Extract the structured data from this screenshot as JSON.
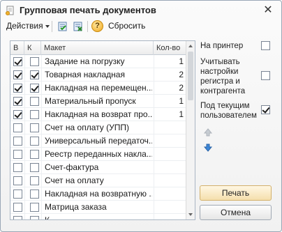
{
  "window": {
    "title": "Групповая печать документов"
  },
  "toolbar": {
    "actions_label": "Действия",
    "reset_label": "Сбросить"
  },
  "table": {
    "columns": [
      "В",
      "К",
      "Макет",
      "Кол-во"
    ],
    "rows": [
      {
        "v": true,
        "k": false,
        "name": "Задание на погрузку",
        "qty": "1"
      },
      {
        "v": true,
        "k": true,
        "name": "Товарная накладная",
        "qty": "2"
      },
      {
        "v": true,
        "k": true,
        "name": "Накладная на перемещен...",
        "qty": "2"
      },
      {
        "v": true,
        "k": false,
        "name": "Материальный пропуск",
        "qty": "1"
      },
      {
        "v": true,
        "k": false,
        "name": "Накладная на возврат про...",
        "qty": "1"
      },
      {
        "v": false,
        "k": false,
        "name": "Счет на оплату (УПП)",
        "qty": ""
      },
      {
        "v": false,
        "k": false,
        "name": "Универсальный передаточ...",
        "qty": ""
      },
      {
        "v": false,
        "k": false,
        "name": "Реестр переданных накла...",
        "qty": ""
      },
      {
        "v": false,
        "k": false,
        "name": "Счет-фактура",
        "qty": ""
      },
      {
        "v": false,
        "k": false,
        "name": "Счет на оплату",
        "qty": ""
      },
      {
        "v": false,
        "k": false,
        "name": "Накладная на возвратную ...",
        "qty": ""
      },
      {
        "v": false,
        "k": false,
        "name": "Матрица заказа",
        "qty": ""
      },
      {
        "v": false,
        "k": false,
        "name": "К...",
        "qty": ""
      }
    ]
  },
  "options": {
    "to_printer_label": "На принтер",
    "to_printer": false,
    "account_settings_label": "Учитывать настройки регистра и контрагента",
    "account_settings": false,
    "current_user_label": "Под текущим пользователем",
    "current_user": true
  },
  "buttons": {
    "print_label": "Печать",
    "cancel_label": "Отмена"
  },
  "colors": {
    "print_button": "#f5dfad",
    "move_up_arrow": "#c7ccd2",
    "move_down_arrow": "#3d86d6"
  }
}
